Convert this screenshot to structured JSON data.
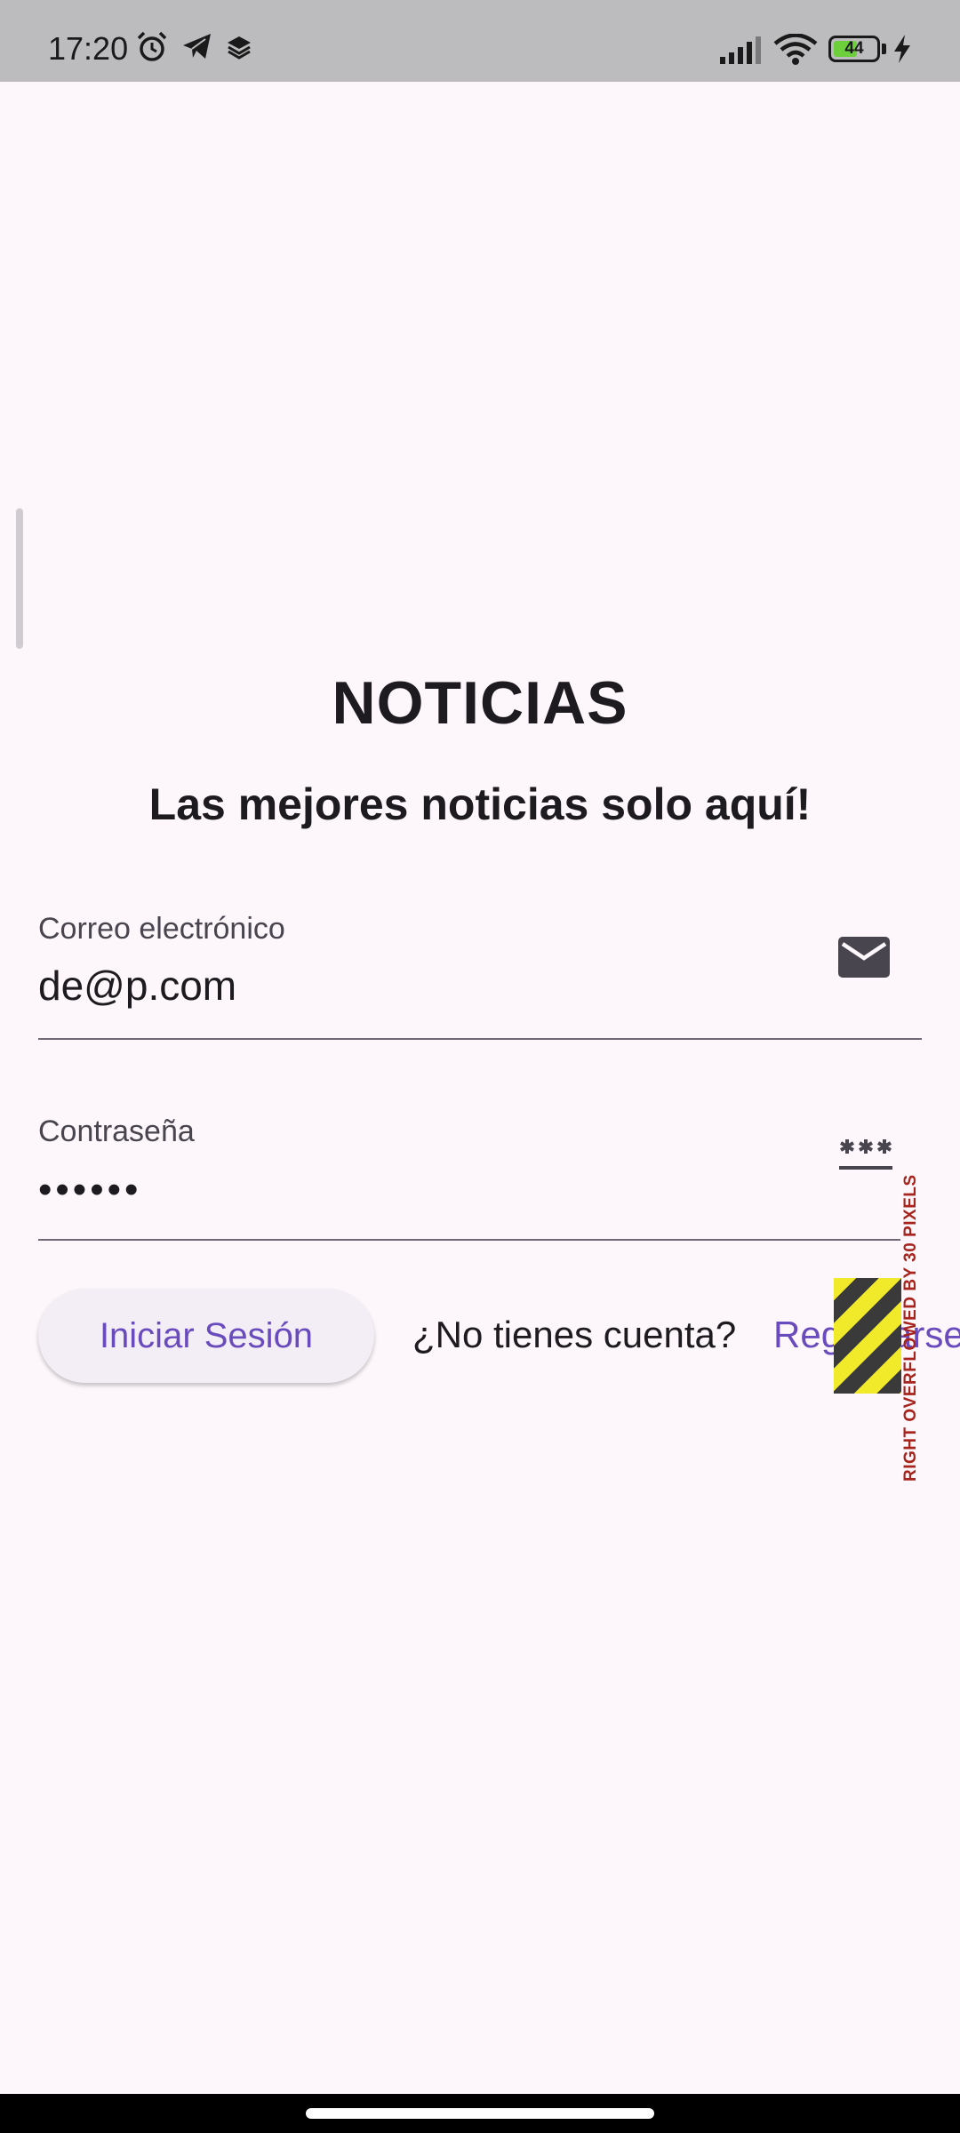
{
  "status_bar": {
    "time": "17:20",
    "battery": "44",
    "icons": [
      "alarm-icon",
      "telegram-icon",
      "layers-icon",
      "signal-icon",
      "wifi-icon",
      "battery-icon",
      "charging-icon"
    ]
  },
  "app": {
    "title": "NOTICIAS",
    "subtitle": "Las mejores noticias solo aquí!"
  },
  "email_field": {
    "label": "Correo electrónico",
    "value": "de@p.com",
    "icon": "mail-icon"
  },
  "password_field": {
    "label": "Contraseña",
    "value": "••••••",
    "icon": "password-icon"
  },
  "actions": {
    "login_label": "Iniciar Sesión",
    "no_account_text": "¿No tienes cuenta?",
    "register_label": "Registrarse"
  },
  "overflow_warning": "RIGHT OVERFLOWED BY 30 PIXELS",
  "colors": {
    "accent": "#6a4bbd",
    "background": "#fdf7fb",
    "status_bar": "#bcbbbe",
    "button_bg": "#f3edf6"
  }
}
